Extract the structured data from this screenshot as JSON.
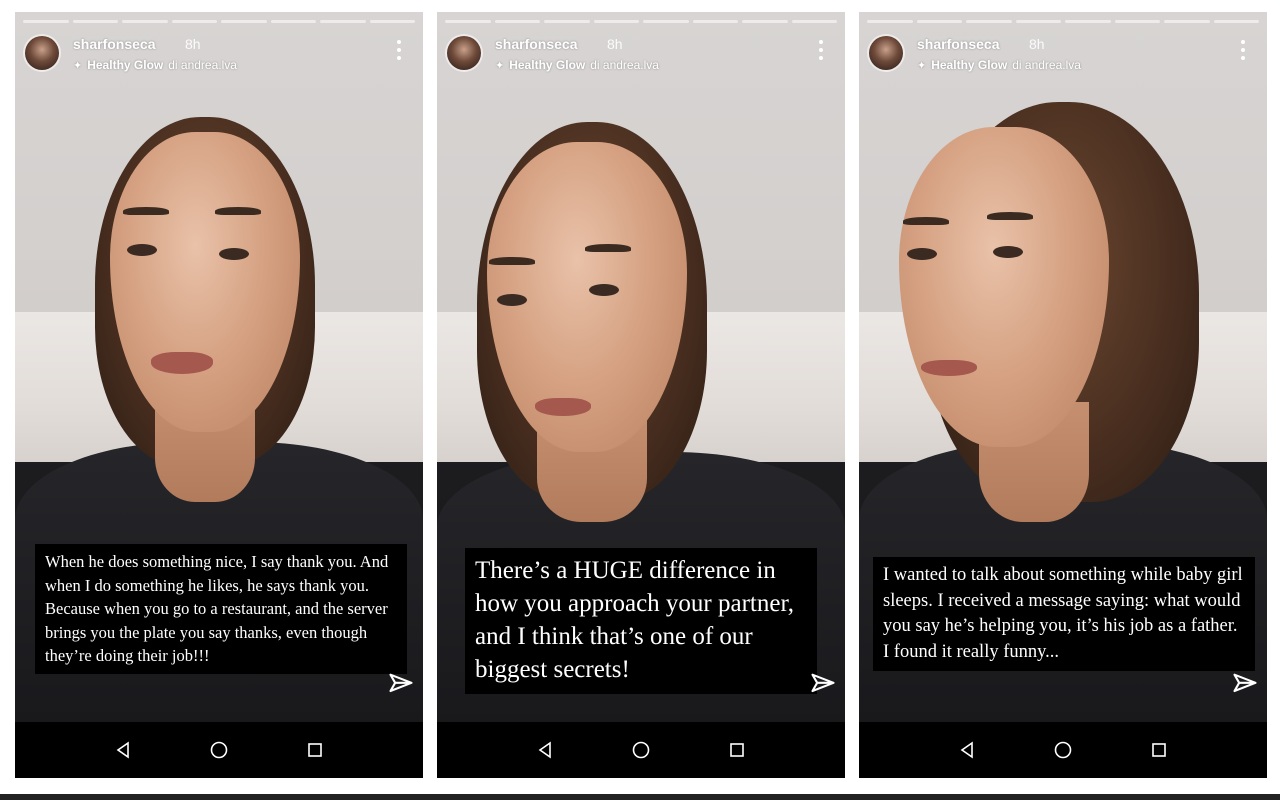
{
  "stories": [
    {
      "username": "sharfonseca",
      "time": "8h",
      "music": {
        "song": "Healthy Glow",
        "by": "di andrea.lva"
      },
      "caption": "When he does something nice, I say thank you. And when I do something he likes, he says thank you. Because when you go to a restaurant, and the server brings you the plate you say thanks, even though they’re doing their job!!!"
    },
    {
      "username": "sharfonseca",
      "time": "8h",
      "music": {
        "song": "Healthy Glow",
        "by": "di andrea.lva"
      },
      "caption": "There’s a HUGE difference in how you approach your partner, and I think that’s one of our biggest secrets!"
    },
    {
      "username": "sharfonseca",
      "time": "8h",
      "music": {
        "song": "Healthy Glow",
        "by": "di andrea.lva"
      },
      "caption": "I wanted to talk about something while baby girl sleeps. I received a message saying: what would you say he’s helping you, it’s his job as a father. I found it really funny..."
    }
  ],
  "icons": {
    "more": "more-vertical-icon",
    "send": "send-icon",
    "music": "sparkle-icon",
    "nav": [
      "back-icon",
      "home-icon",
      "recents-icon"
    ]
  },
  "colors": {
    "caption_bg": "#000000",
    "caption_text": "#ffffff",
    "navbar_bg": "#000000"
  }
}
